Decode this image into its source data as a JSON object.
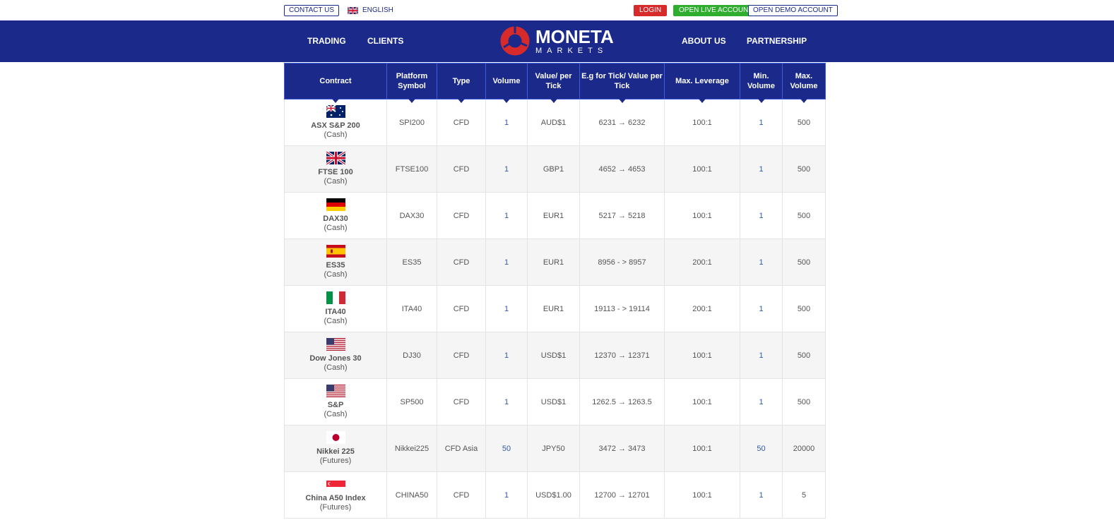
{
  "topbar": {
    "contact": "CONTACT US",
    "language": "ENGLISH",
    "login": "LOGIN",
    "live": "OPEN LIVE ACCOUNT",
    "demo": "OPEN DEMO ACCOUNT"
  },
  "nav": {
    "trading": "TRADING",
    "clients": "CLIENTS",
    "about": "ABOUT US",
    "partnership": "PARTNERSHIP",
    "logo_main": "MONETA",
    "logo_sub": "MARKETS"
  },
  "colors": {
    "brand": "#1b2a8a",
    "login": "#d72a2a",
    "live": "#2ead2e"
  },
  "table": {
    "headers": [
      "Contract",
      "Platform Symbol",
      "Type",
      "Volume",
      "Value/ per Tick",
      "E.g for Tick/ Value per Tick",
      "Max. Leverage",
      "Min. Volume",
      "Max. Volume"
    ],
    "rows": [
      {
        "flag": "au",
        "name": "ASX S&P 200",
        "sub": "(Cash)",
        "symbol": "SPI200",
        "type": "CFD",
        "volume": "1",
        "value": "AUD$1",
        "tick": "6231 → 6232",
        "leverage": "100:1",
        "min": "1",
        "max": "500"
      },
      {
        "flag": "gb",
        "name": "FTSE 100",
        "sub": "(Cash)",
        "symbol": "FTSE100",
        "type": "CFD",
        "volume": "1",
        "value": "GBP1",
        "tick": "4652 → 4653",
        "leverage": "100:1",
        "min": "1",
        "max": "500"
      },
      {
        "flag": "de",
        "name": "DAX30",
        "sub": "(Cash)",
        "symbol": "DAX30",
        "type": "CFD",
        "volume": "1",
        "value": "EUR1",
        "tick": "5217 → 5218",
        "leverage": "100:1",
        "min": "1",
        "max": "500"
      },
      {
        "flag": "es",
        "name": "ES35",
        "sub": "(Cash)",
        "symbol": "ES35",
        "type": "CFD",
        "volume": "1",
        "value": "EUR1",
        "tick": "8956 - > 8957",
        "leverage": "200:1",
        "min": "1",
        "max": "500"
      },
      {
        "flag": "it",
        "name": "ITA40",
        "sub": "(Cash)",
        "symbol": "ITA40",
        "type": "CFD",
        "volume": "1",
        "value": "EUR1",
        "tick": "19113 - > 19114",
        "leverage": "200:1",
        "min": "1",
        "max": "500"
      },
      {
        "flag": "us",
        "name": "Dow Jones 30",
        "sub": "(Cash)",
        "symbol": "DJ30",
        "type": "CFD",
        "volume": "1",
        "value": "USD$1",
        "tick": "12370 → 12371",
        "leverage": "100:1",
        "min": "1",
        "max": "500"
      },
      {
        "flag": "us",
        "name": "S&P",
        "sub": "(Cash)",
        "symbol": "SP500",
        "type": "CFD",
        "volume": "1",
        "value": "USD$1",
        "tick": "1262.5 → 1263.5",
        "leverage": "100:1",
        "min": "1",
        "max": "500"
      },
      {
        "flag": "jp",
        "name": "Nikkei 225",
        "sub": "(Futures)",
        "symbol": "Nikkei225",
        "type": "CFD Asia",
        "volume": "50",
        "value": "JPY50",
        "tick": "3472 → 3473",
        "leverage": "100:1",
        "min": "50",
        "max": "20000"
      },
      {
        "flag": "sg",
        "name": "China A50 Index",
        "sub": "(Futures)",
        "symbol": "CHINA50",
        "type": "CFD",
        "volume": "1",
        "value": "USD$1.00",
        "tick": "12700 → 12701",
        "leverage": "100:1",
        "min": "1",
        "max": "5"
      }
    ]
  }
}
